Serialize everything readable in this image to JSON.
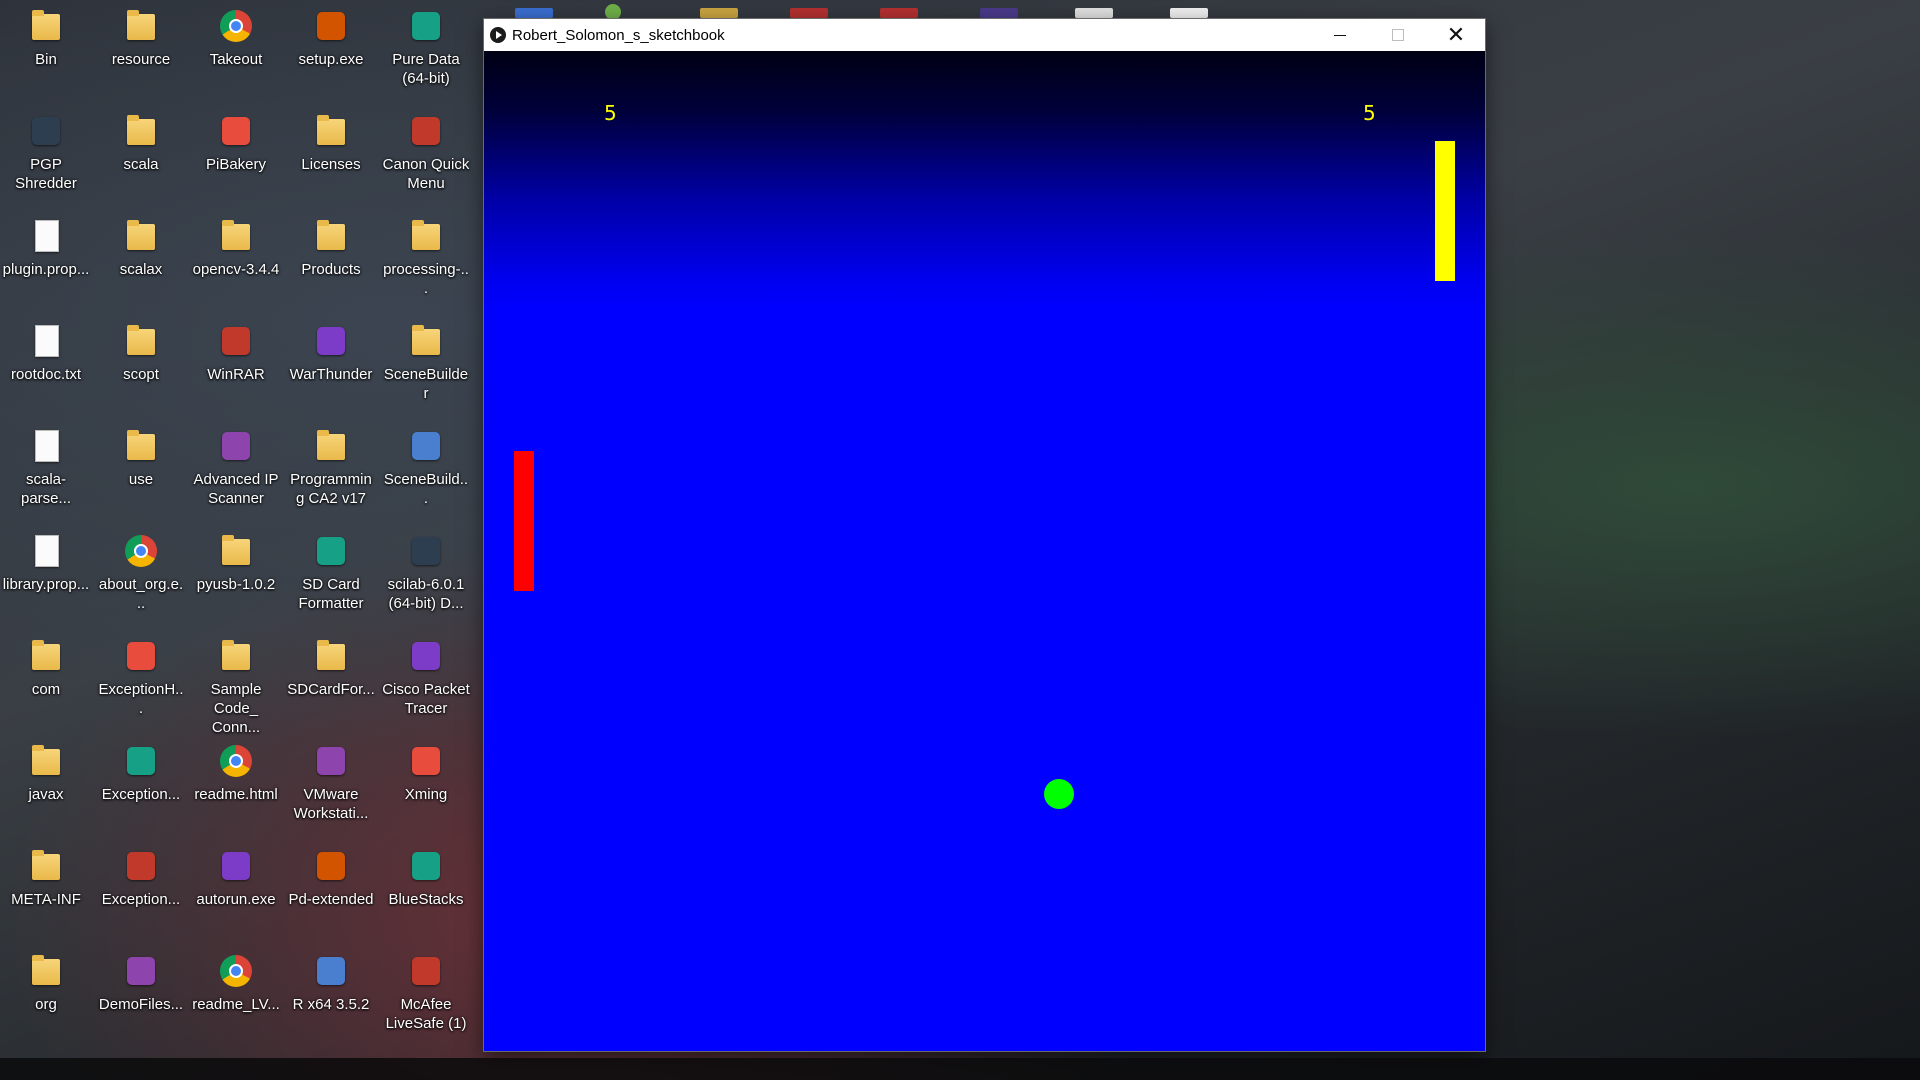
{
  "window": {
    "title": "Robert_Solomon_s_sketchbook",
    "controls": {
      "minimize": "—",
      "maximize": "☐",
      "close": "✕"
    }
  },
  "game": {
    "score_left": "5",
    "score_right": "5",
    "colors": {
      "background": "#0000ff",
      "score": "#ffff00",
      "paddle_left": "#ff0000",
      "paddle_right": "#ffff00",
      "ball": "#00ff00"
    }
  },
  "desktop": {
    "icons": [
      {
        "label": "Bin",
        "type": "folder"
      },
      {
        "label": "resource",
        "type": "folder"
      },
      {
        "label": "Takeout",
        "type": "chrome"
      },
      {
        "label": "setup.exe",
        "type": "app"
      },
      {
        "label": "Pure Data (64-bit)",
        "type": "app"
      },
      {
        "label": "PGP Shredder",
        "type": "app"
      },
      {
        "label": "scala",
        "type": "folder"
      },
      {
        "label": "PiBakery",
        "type": "app"
      },
      {
        "label": "Licenses",
        "type": "folder"
      },
      {
        "label": "Canon Quick Menu",
        "type": "app"
      },
      {
        "label": "plugin.prop...",
        "type": "file"
      },
      {
        "label": "scalax",
        "type": "folder"
      },
      {
        "label": "opencv-3.4.4",
        "type": "folder"
      },
      {
        "label": "Products",
        "type": "folder"
      },
      {
        "label": "processing-...",
        "type": "folder"
      },
      {
        "label": "rootdoc.txt",
        "type": "file"
      },
      {
        "label": "scopt",
        "type": "folder"
      },
      {
        "label": "WinRAR",
        "type": "app"
      },
      {
        "label": "WarThunder",
        "type": "app"
      },
      {
        "label": "SceneBuilder",
        "type": "folder"
      },
      {
        "label": "scala-parse...",
        "type": "file"
      },
      {
        "label": "use",
        "type": "folder"
      },
      {
        "label": "Advanced IP Scanner",
        "type": "app"
      },
      {
        "label": "Programming CA2 v17",
        "type": "folder"
      },
      {
        "label": "SceneBuild...",
        "type": "app"
      },
      {
        "label": "library.prop...",
        "type": "file"
      },
      {
        "label": "about_org.e...",
        "type": "chrome"
      },
      {
        "label": "pyusb-1.0.2",
        "type": "folder"
      },
      {
        "label": "SD Card Formatter",
        "type": "app"
      },
      {
        "label": "scilab-6.0.1 (64-bit) D...",
        "type": "app"
      },
      {
        "label": "com",
        "type": "folder"
      },
      {
        "label": "ExceptionH...",
        "type": "app"
      },
      {
        "label": "Sample Code_ Conn...",
        "type": "folder"
      },
      {
        "label": "SDCardFor...",
        "type": "folder"
      },
      {
        "label": "Cisco Packet Tracer",
        "type": "app"
      },
      {
        "label": "javax",
        "type": "folder"
      },
      {
        "label": "Exception...",
        "type": "app"
      },
      {
        "label": "readme.html",
        "type": "chrome"
      },
      {
        "label": "VMware Workstati...",
        "type": "app"
      },
      {
        "label": "Xming",
        "type": "app"
      },
      {
        "label": "META-INF",
        "type": "folder"
      },
      {
        "label": "Exception...",
        "type": "app"
      },
      {
        "label": "autorun.exe",
        "type": "app"
      },
      {
        "label": "Pd-extended",
        "type": "app"
      },
      {
        "label": "BlueStacks",
        "type": "app"
      },
      {
        "label": "org",
        "type": "folder"
      },
      {
        "label": "DemoFiles...",
        "type": "app"
      },
      {
        "label": "readme_LV...",
        "type": "chrome"
      },
      {
        "label": "R x64 3.5.2",
        "type": "app"
      },
      {
        "label": "McAfee LiveSafe (1)",
        "type": "app"
      }
    ]
  }
}
